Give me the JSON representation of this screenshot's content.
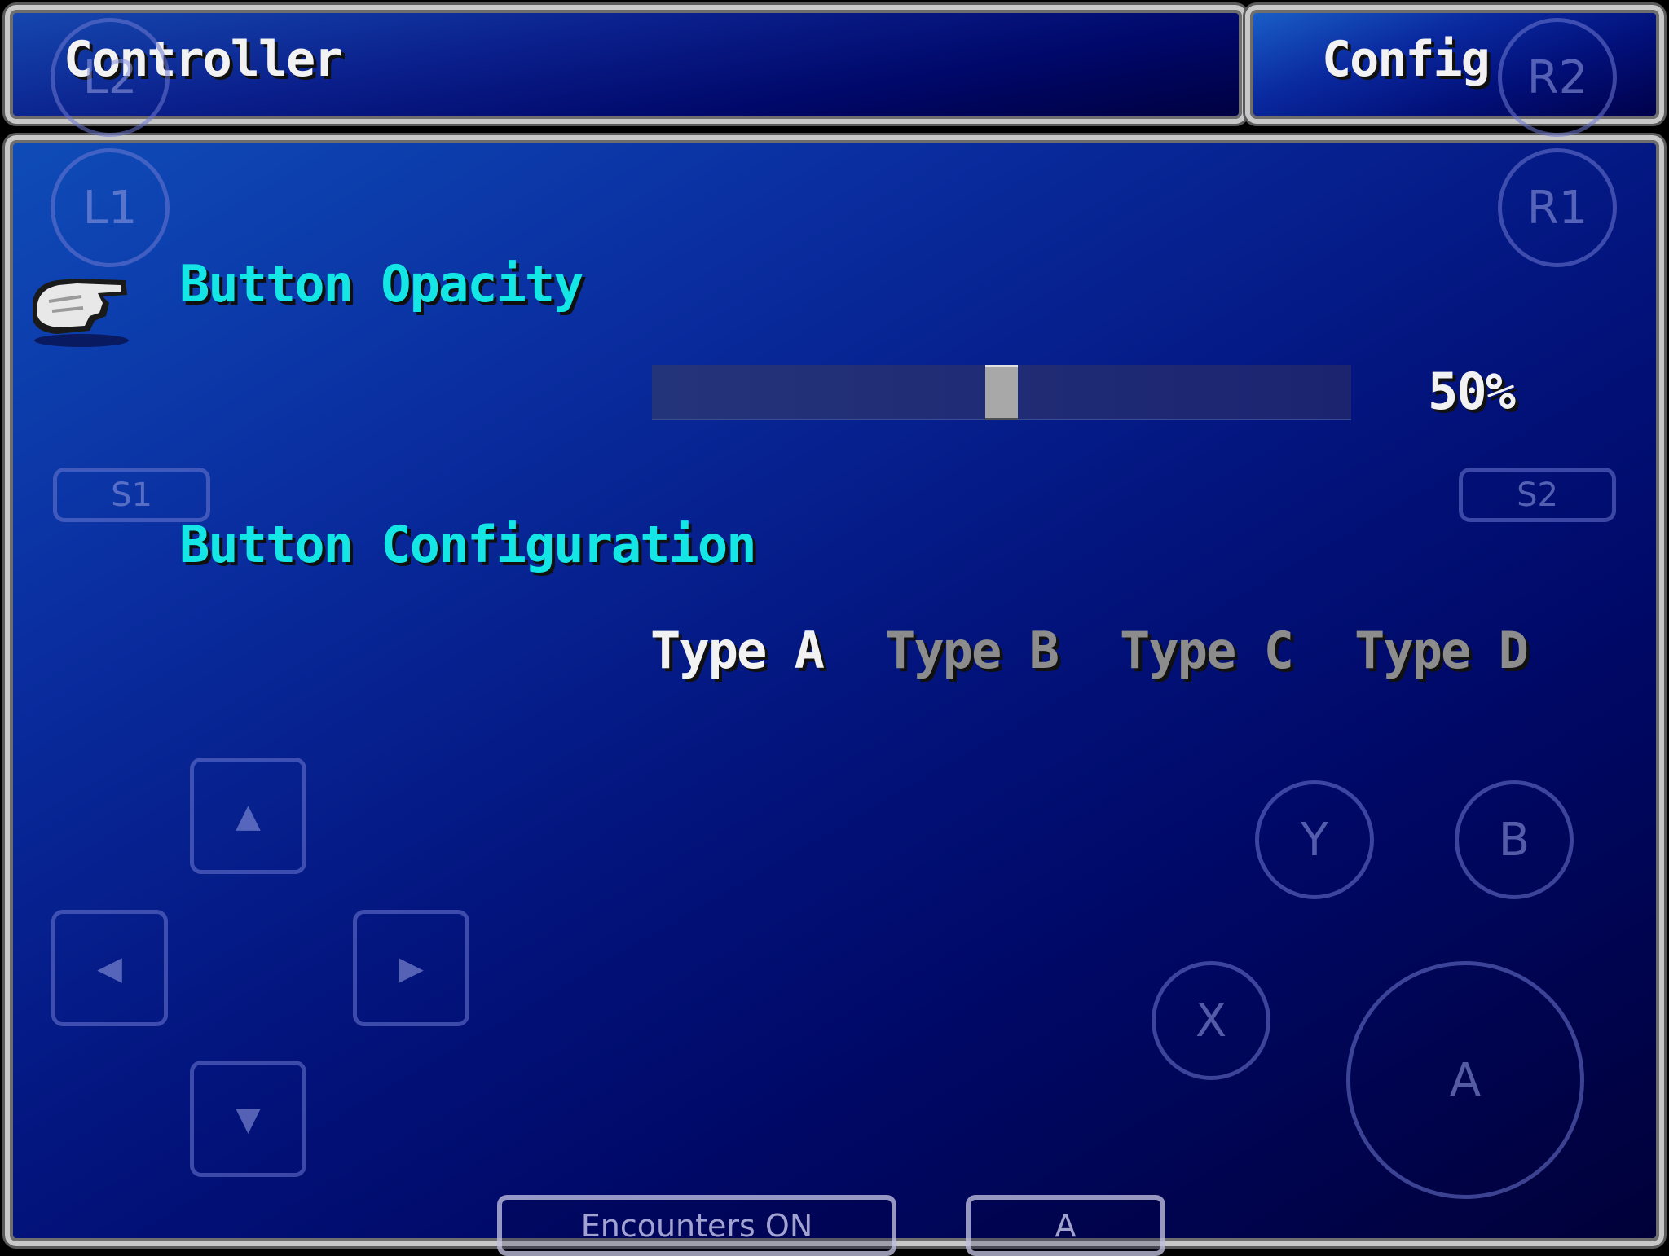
{
  "header": {
    "title": "Controller",
    "tab": "Config"
  },
  "settings": {
    "opacity": {
      "label": "Button Opacity",
      "value_percent": 50,
      "value_text": "50%"
    },
    "configuration": {
      "label": "Button Configuration",
      "options": [
        "Type A",
        "Type B",
        "Type C",
        "Type D"
      ],
      "selected_index": 0
    }
  },
  "cursor": {
    "icon": "pointing-hand-icon"
  },
  "overlay_controls": {
    "shoulder": {
      "l2": "L2",
      "l1": "L1",
      "r2": "R2",
      "r1": "R1"
    },
    "select_start": {
      "s1": "S1",
      "s2": "S2"
    },
    "dpad": {
      "up": "▲",
      "down": "▼",
      "left": "◀",
      "right": "▶"
    },
    "face": {
      "y": "Y",
      "b": "B",
      "x": "X",
      "a": "A"
    },
    "bottom": {
      "encounters": "Encounters ON",
      "a": "A"
    }
  },
  "colors": {
    "heading": "#14e6e6",
    "selected": "#f2f2f2",
    "unselected": "#8c8c8c",
    "panel_top": "#0f4cb8",
    "panel_bottom": "#000038"
  }
}
